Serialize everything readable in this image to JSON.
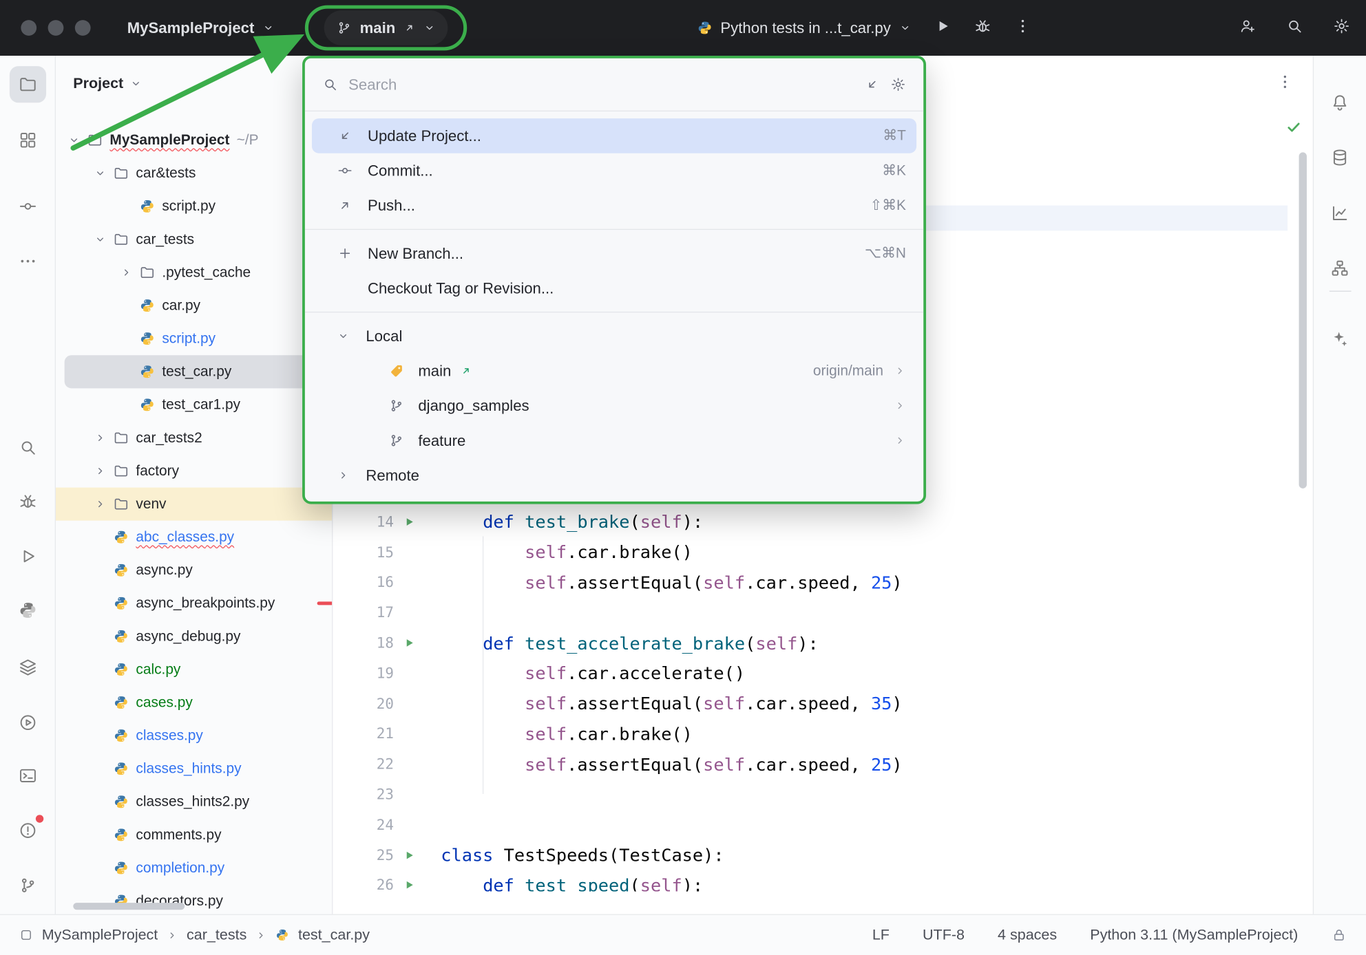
{
  "colors": {
    "annotation": "#3BAE4B",
    "selection": "#D7E2FA",
    "run_green": "#59A869"
  },
  "titlebar": {
    "project_name": "MySampleProject",
    "branch_name": "main",
    "run_config": "Python tests in ...t_car.py"
  },
  "left_rail": {
    "top": [
      {
        "name": "project",
        "icon": "folder",
        "active": true
      },
      {
        "name": "structure",
        "icon": "grid"
      },
      {
        "name": "commit",
        "icon": "commit"
      },
      {
        "name": "more-tools",
        "icon": "more"
      }
    ],
    "bottom": [
      {
        "name": "search",
        "icon": "search"
      },
      {
        "name": "debug",
        "icon": "bug"
      },
      {
        "name": "run",
        "icon": "playOutline"
      },
      {
        "name": "python-console",
        "icon": "python"
      },
      {
        "name": "services",
        "icon": "layers"
      },
      {
        "name": "run-anything",
        "icon": "circlePlay"
      },
      {
        "name": "terminal",
        "icon": "terminal"
      },
      {
        "name": "problems",
        "icon": "problems",
        "badge": true
      },
      {
        "name": "version-control",
        "icon": "branch"
      }
    ]
  },
  "right_rail": [
    {
      "name": "notifications",
      "icon": "bell"
    },
    {
      "name": "database",
      "icon": "db"
    },
    {
      "name": "plots",
      "icon": "chart"
    },
    {
      "name": "structure-hierarchy",
      "icon": "hierarchy"
    },
    {
      "name": "ai-assistant",
      "icon": "sparkle"
    }
  ],
  "project_panel": {
    "header": "Project",
    "tree": [
      {
        "label": "MySampleProject",
        "kind": "root",
        "depth": 0,
        "expanded": true,
        "bold": true,
        "squiggle": true,
        "suffix": "~/P"
      },
      {
        "label": "car&tests",
        "kind": "folder",
        "depth": 1,
        "expanded": true
      },
      {
        "label": "script.py",
        "kind": "file",
        "depth": 2
      },
      {
        "label": "car_tests",
        "kind": "folder",
        "depth": 1,
        "expanded": true
      },
      {
        "label": ".pytest_cache",
        "kind": "folder",
        "depth": 2,
        "expanded": false
      },
      {
        "label": "car.py",
        "kind": "file",
        "depth": 2
      },
      {
        "label": "script.py",
        "kind": "file",
        "depth": 2,
        "color": "blue"
      },
      {
        "label": "test_car.py",
        "kind": "file",
        "depth": 2,
        "selected": true
      },
      {
        "label": "test_car1.py",
        "kind": "file",
        "depth": 2
      },
      {
        "label": "car_tests2",
        "kind": "folder",
        "depth": 1,
        "expanded": false
      },
      {
        "label": "factory",
        "kind": "folder",
        "depth": 1,
        "expanded": false
      },
      {
        "label": "venv",
        "kind": "folder",
        "depth": 1,
        "expanded": false,
        "highlight": true,
        "folderColor": "orange"
      },
      {
        "label": "abc_classes.py",
        "kind": "file",
        "depth": 1,
        "color": "blue",
        "squiggle": true
      },
      {
        "label": "async.py",
        "kind": "file",
        "depth": 1
      },
      {
        "label": "async_breakpoints.py",
        "kind": "file",
        "depth": 1,
        "mark": "red-dash"
      },
      {
        "label": "async_debug.py",
        "kind": "file",
        "depth": 1
      },
      {
        "label": "calc.py",
        "kind": "file",
        "depth": 1,
        "color": "green"
      },
      {
        "label": "cases.py",
        "kind": "file",
        "depth": 1,
        "color": "green"
      },
      {
        "label": "classes.py",
        "kind": "file",
        "depth": 1,
        "color": "blue"
      },
      {
        "label": "classes_hints.py",
        "kind": "file",
        "depth": 1,
        "color": "blue"
      },
      {
        "label": "classes_hints2.py",
        "kind": "file",
        "depth": 1
      },
      {
        "label": "comments.py",
        "kind": "file",
        "depth": 1
      },
      {
        "label": "completion.py",
        "kind": "file",
        "depth": 1,
        "color": "blue"
      },
      {
        "label": "decorators.py",
        "kind": "file",
        "depth": 1
      }
    ]
  },
  "branch_popup": {
    "search_placeholder": "Search",
    "groups": [
      [
        {
          "icon": "update",
          "label": "Update Project...",
          "shortcut": "⌘T",
          "selected": true
        },
        {
          "icon": "commit",
          "label": "Commit...",
          "shortcut": "⌘K"
        },
        {
          "icon": "push",
          "label": "Push...",
          "shortcut": "⇧⌘K"
        }
      ],
      [
        {
          "icon": "plus",
          "label": "New Branch...",
          "shortcut": "⌥⌘N"
        },
        {
          "icon": "none",
          "label": "Checkout Tag or Revision...",
          "shortcut": ""
        }
      ]
    ],
    "local_header": "Local",
    "local_branches": [
      {
        "icon": "tag",
        "label": "main",
        "current": true,
        "trailing": "origin/main"
      },
      {
        "icon": "branch",
        "label": "django_samples",
        "trailing": ""
      },
      {
        "icon": "branch",
        "label": "feature",
        "trailing": ""
      }
    ],
    "remote_header": "Remote"
  },
  "editor": {
    "code_lines": [
      {
        "n": 14,
        "run": true,
        "tokens": [
          [
            "ind",
            "    "
          ],
          [
            "kw",
            "def"
          ],
          [
            "pl",
            " "
          ],
          [
            "fn",
            "test_brake"
          ],
          [
            "pl",
            "("
          ],
          [
            "sf",
            "self"
          ],
          [
            "pl",
            "):"
          ]
        ]
      },
      {
        "n": 15,
        "run": false,
        "tokens": [
          [
            "ind",
            "        "
          ],
          [
            "sf",
            "self"
          ],
          [
            "pl",
            ".car.brake()"
          ]
        ]
      },
      {
        "n": 16,
        "run": false,
        "tokens": [
          [
            "ind",
            "        "
          ],
          [
            "sf",
            "self"
          ],
          [
            "pl",
            ".assertEqual("
          ],
          [
            "sf",
            "self"
          ],
          [
            "pl",
            ".car.speed, "
          ],
          [
            "num",
            "25"
          ],
          [
            "pl",
            ")"
          ]
        ]
      },
      {
        "n": 17,
        "run": false,
        "tokens": []
      },
      {
        "n": 18,
        "run": true,
        "tokens": [
          [
            "ind",
            "    "
          ],
          [
            "kw",
            "def"
          ],
          [
            "pl",
            " "
          ],
          [
            "fn",
            "test_accelerate_brake"
          ],
          [
            "pl",
            "("
          ],
          [
            "sf",
            "self"
          ],
          [
            "pl",
            "):"
          ]
        ]
      },
      {
        "n": 19,
        "run": false,
        "tokens": [
          [
            "ind",
            "        "
          ],
          [
            "sf",
            "self"
          ],
          [
            "pl",
            ".car.accelerate()"
          ]
        ]
      },
      {
        "n": 20,
        "run": false,
        "tokens": [
          [
            "ind",
            "        "
          ],
          [
            "sf",
            "self"
          ],
          [
            "pl",
            ".assertEqual("
          ],
          [
            "sf",
            "self"
          ],
          [
            "pl",
            ".car.speed, "
          ],
          [
            "num",
            "35"
          ],
          [
            "pl",
            ")"
          ]
        ]
      },
      {
        "n": 21,
        "run": false,
        "tokens": [
          [
            "ind",
            "        "
          ],
          [
            "sf",
            "self"
          ],
          [
            "pl",
            ".car.brake()"
          ]
        ]
      },
      {
        "n": 22,
        "run": false,
        "tokens": [
          [
            "ind",
            "        "
          ],
          [
            "sf",
            "self"
          ],
          [
            "pl",
            ".assertEqual("
          ],
          [
            "sf",
            "self"
          ],
          [
            "pl",
            ".car.speed, "
          ],
          [
            "num",
            "25"
          ],
          [
            "pl",
            ")"
          ]
        ]
      },
      {
        "n": 23,
        "run": false,
        "tokens": []
      },
      {
        "n": 24,
        "run": false,
        "tokens": []
      },
      {
        "n": 25,
        "run": true,
        "tokens": [
          [
            "kw",
            "class"
          ],
          [
            "pl",
            " TestSpeeds(TestCase):"
          ]
        ]
      },
      {
        "n": 26,
        "run": true,
        "tokens": [
          [
            "ind",
            "    "
          ],
          [
            "kw",
            "def"
          ],
          [
            "pl",
            " "
          ],
          [
            "fn",
            "test_speed"
          ],
          [
            "pl",
            "("
          ],
          [
            "sf",
            "self"
          ],
          [
            "pl",
            "):"
          ]
        ]
      }
    ]
  },
  "status_bar": {
    "breadcrumbs": [
      "MySampleProject",
      "car_tests",
      "test_car.py"
    ],
    "right_items": [
      "LF",
      "UTF-8",
      "4 spaces",
      "Python 3.11 (MySampleProject)"
    ]
  }
}
